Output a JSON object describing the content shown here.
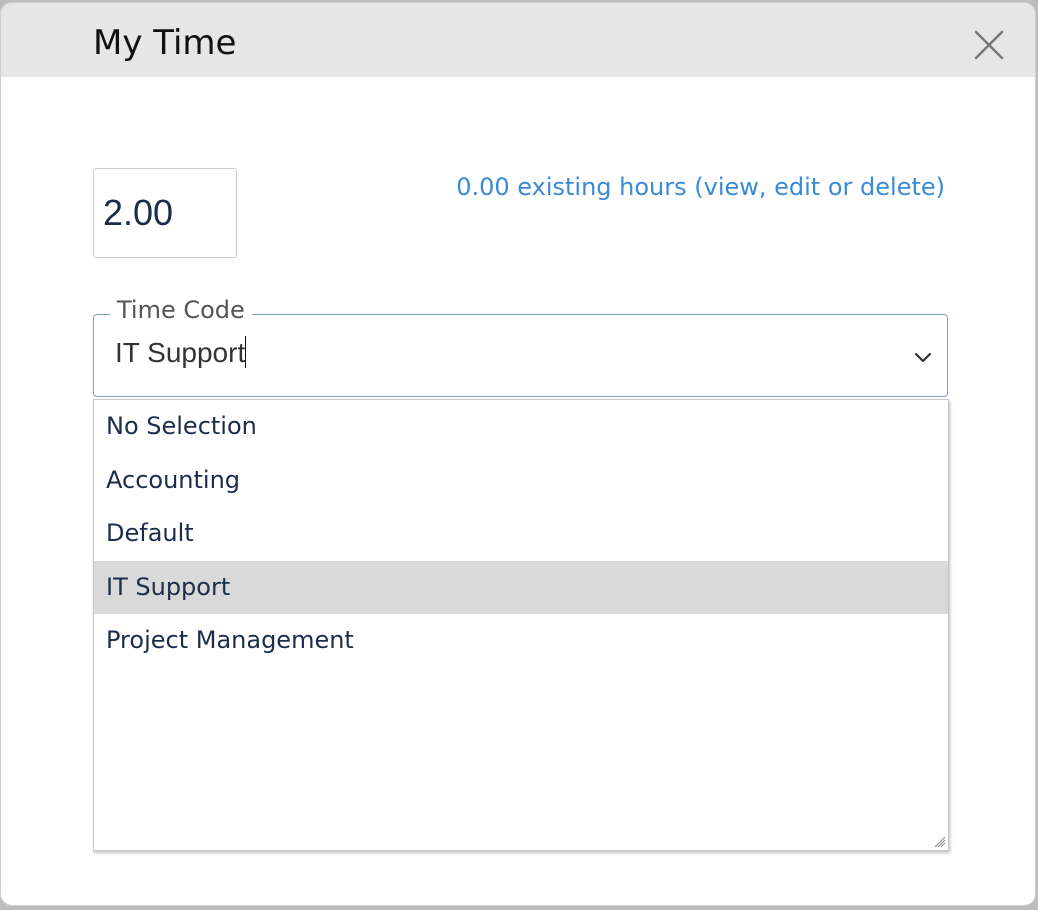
{
  "dialog": {
    "title": "My Time"
  },
  "hours": {
    "value": "2.00"
  },
  "existing_hours_link": "0.00 existing hours (view, edit or delete)",
  "time_code": {
    "label": "Time Code",
    "value": "IT Support",
    "options": [
      {
        "label": "No Selection",
        "selected": false
      },
      {
        "label": "Accounting",
        "selected": false
      },
      {
        "label": "Default",
        "selected": false
      },
      {
        "label": "IT Support",
        "selected": true
      },
      {
        "label": "Project Management",
        "selected": false
      }
    ]
  },
  "colors": {
    "header_bg": "#e6e6e6",
    "link": "#3a8bd6",
    "text_dark_blue": "#1b2d4a",
    "selected_bg": "#d9d9d9",
    "field_border": "#7fa0c4"
  },
  "icons": {
    "close": "close-icon",
    "chevron": "chevron-down-icon",
    "resize": "resize-grip-icon"
  }
}
